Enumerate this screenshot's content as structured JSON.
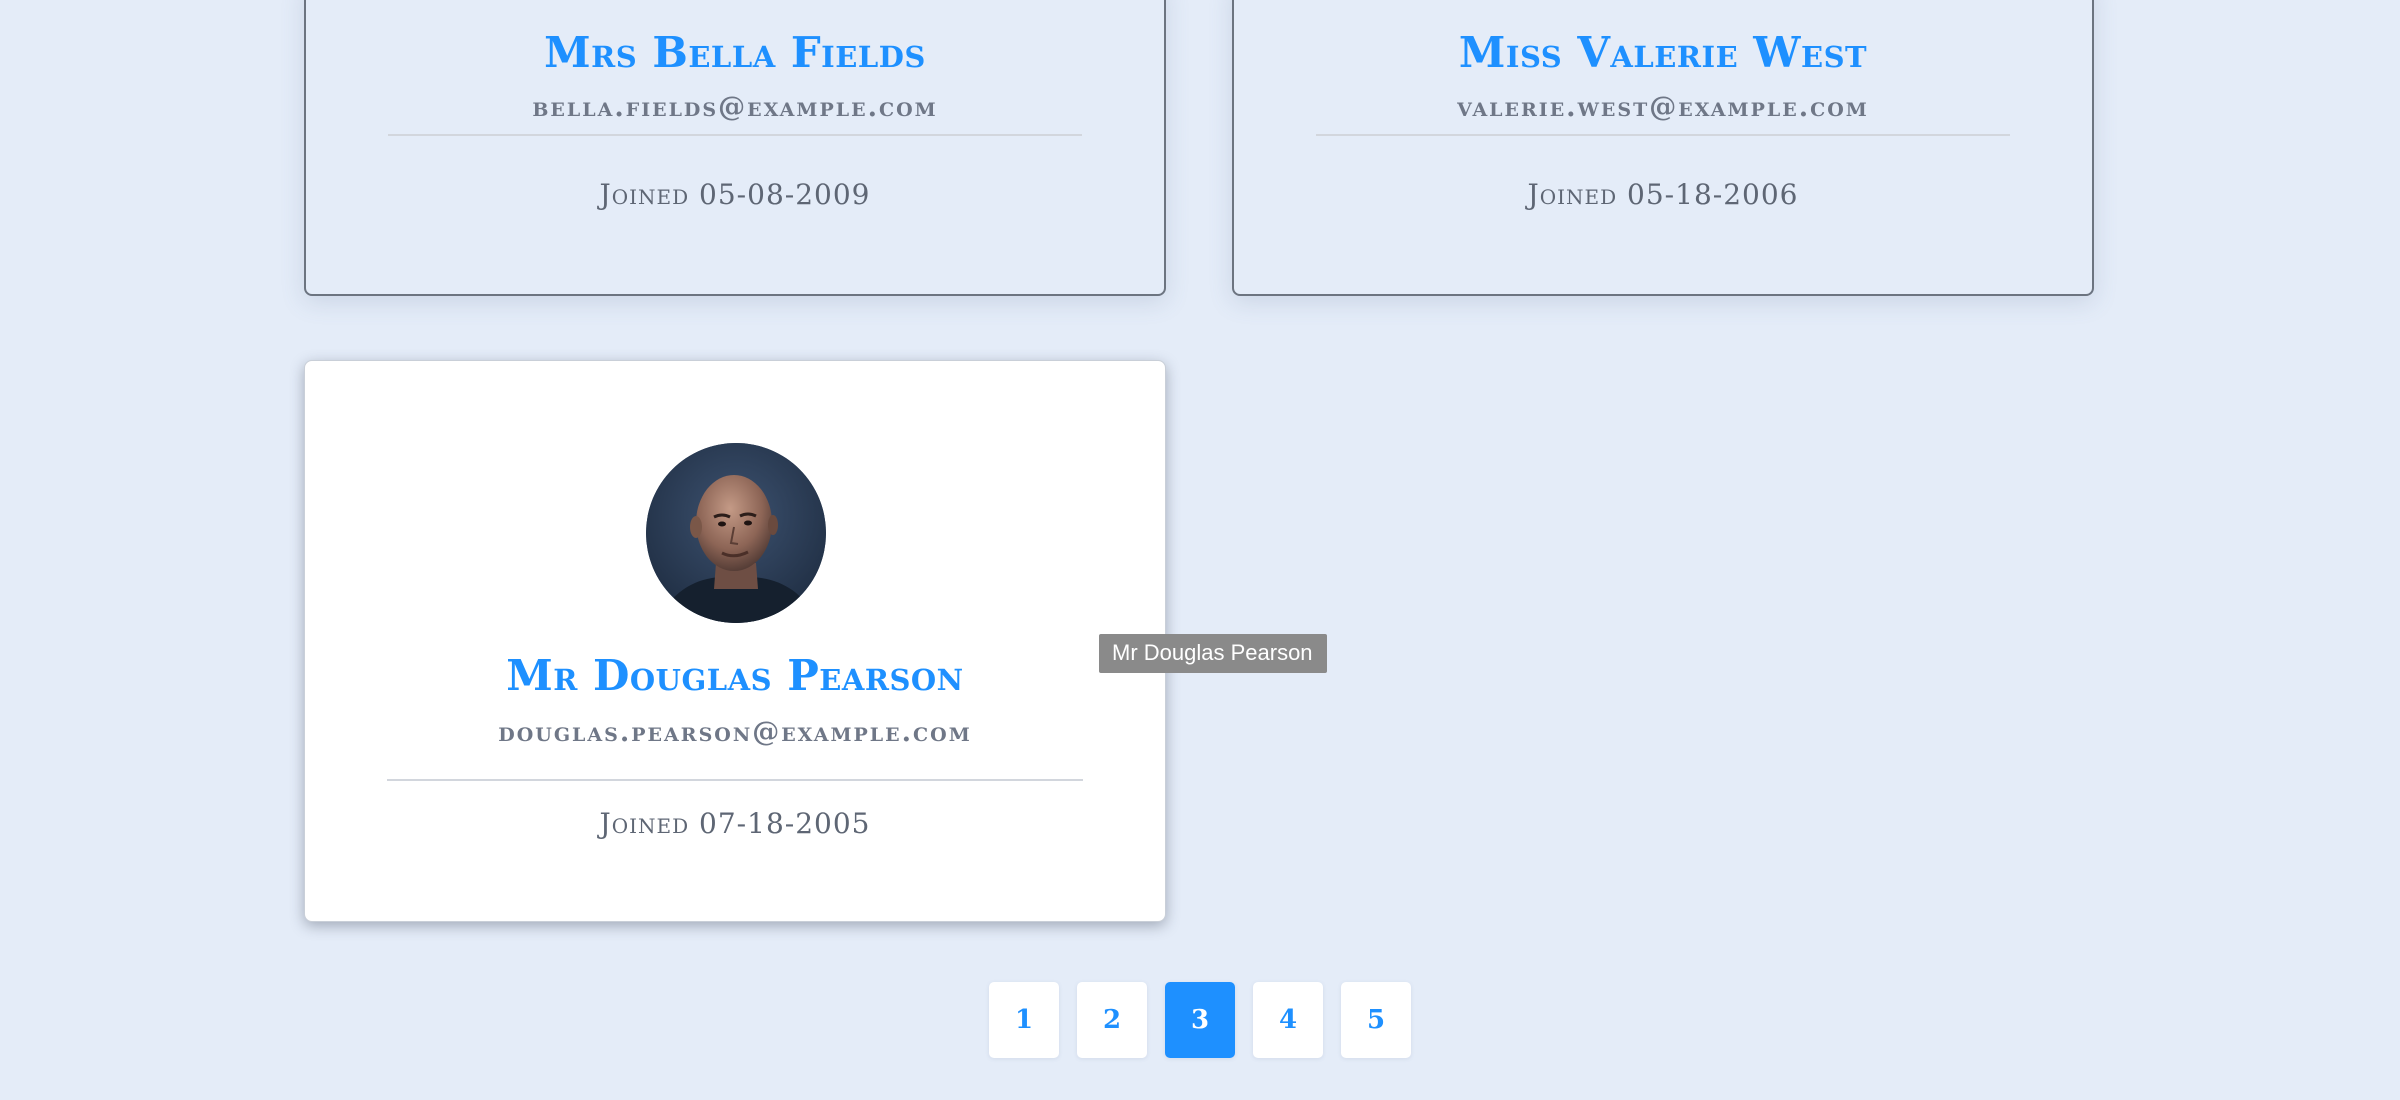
{
  "cards": [
    {
      "name": "Mrs Bella Fields",
      "email": "bella.fields@example.com",
      "joined": "Joined 05-08-2009"
    },
    {
      "name": "Miss Valerie West",
      "email": "valerie.west@example.com",
      "joined": "Joined 05-18-2006"
    },
    {
      "name": "Mr Douglas Pearson",
      "email": "douglas.pearson@example.com",
      "joined": "Joined 07-18-2005"
    }
  ],
  "tooltip": {
    "text": "Mr Douglas Pearson"
  },
  "pagination": {
    "pages": [
      "1",
      "2",
      "3",
      "4",
      "5"
    ],
    "current": "3"
  },
  "colors": {
    "accent": "#1e90ff",
    "background": "#e4ecf8",
    "card_active": "#ffffff",
    "tooltip_bg": "#8a8a8a"
  }
}
